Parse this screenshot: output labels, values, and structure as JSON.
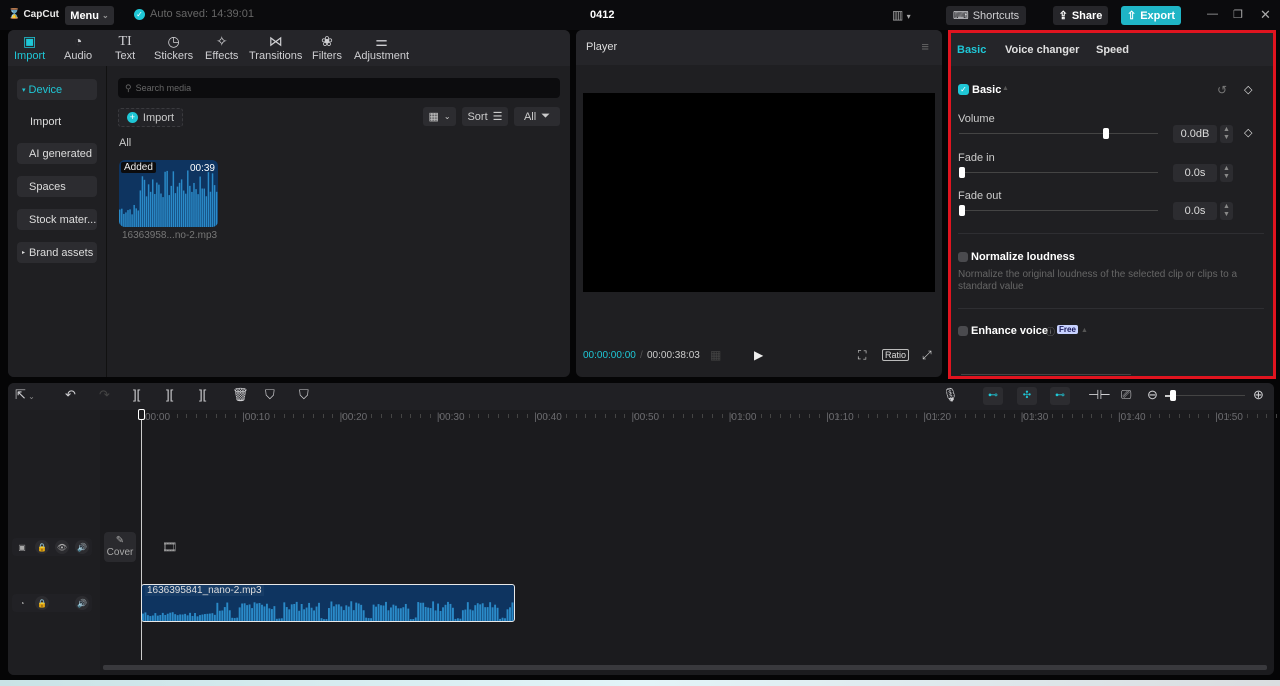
{
  "app": {
    "name": "CapCut",
    "menu_label": "Menu",
    "autosave_text": "Auto saved: 14:39:01",
    "project_title": "0412"
  },
  "topbar": {
    "shortcuts_label": "Shortcuts",
    "share_label": "Share",
    "export_label": "Export",
    "accent": "#1fc7d6"
  },
  "media_tabs": [
    {
      "label": "Import",
      "icon": "import-icon",
      "active": true
    },
    {
      "label": "Audio",
      "icon": "audio-icon"
    },
    {
      "label": "Text",
      "icon": "text-icon"
    },
    {
      "label": "Stickers",
      "icon": "stickers-icon"
    },
    {
      "label": "Effects",
      "icon": "effects-icon"
    },
    {
      "label": "Transitions",
      "icon": "transitions-icon"
    },
    {
      "label": "Filters",
      "icon": "filters-icon"
    },
    {
      "label": "Adjustment",
      "icon": "adjustment-icon"
    }
  ],
  "sidebar": {
    "items": [
      {
        "label": "Device",
        "active": true
      },
      {
        "label": "Import"
      },
      {
        "label": "AI generated"
      },
      {
        "label": "Spaces"
      },
      {
        "label": "Stock mater..."
      },
      {
        "label": "Brand assets"
      }
    ]
  },
  "media": {
    "search_placeholder": "Search media",
    "import_label": "Import",
    "sort_label": "Sort",
    "filter_label": "All",
    "section_label": "All",
    "item": {
      "badge": "Added",
      "duration": "00:39",
      "filename": "16363958...no-2.mp3"
    }
  },
  "player": {
    "title": "Player",
    "current_time": "00:00:00:00",
    "total_time": "00:00:38:03",
    "ratio_label": "Ratio"
  },
  "properties": {
    "tabs": [
      "Basic",
      "Voice changer",
      "Speed"
    ],
    "active_tab": "Basic",
    "basic_section": "Basic",
    "volume": {
      "label": "Volume",
      "value": "0.0dB",
      "slider_fraction": 0.74
    },
    "fade_in": {
      "label": "Fade in",
      "value": "0.0s",
      "slider_fraction": 0
    },
    "fade_out": {
      "label": "Fade out",
      "value": "0.0s",
      "slider_fraction": 0
    },
    "normalize": {
      "label": "Normalize loudness",
      "description": "Normalize the original loudness of the selected clip or clips to a standard value",
      "checked": false
    },
    "enhance": {
      "label": "Enhance voice",
      "badge": "Free",
      "checked": false
    }
  },
  "timeline": {
    "ruler": [
      "00:00",
      "|00:10",
      "|00:20",
      "|00:30",
      "|00:40",
      "|00:50",
      "|01:00",
      "|01:10",
      "|01:20",
      "|01:30",
      "|01:40",
      "|01:50"
    ],
    "cover_label": "Cover",
    "audio_clip_name": "1636395841_nano-2.mp3",
    "zoom_fraction": 0.1
  }
}
